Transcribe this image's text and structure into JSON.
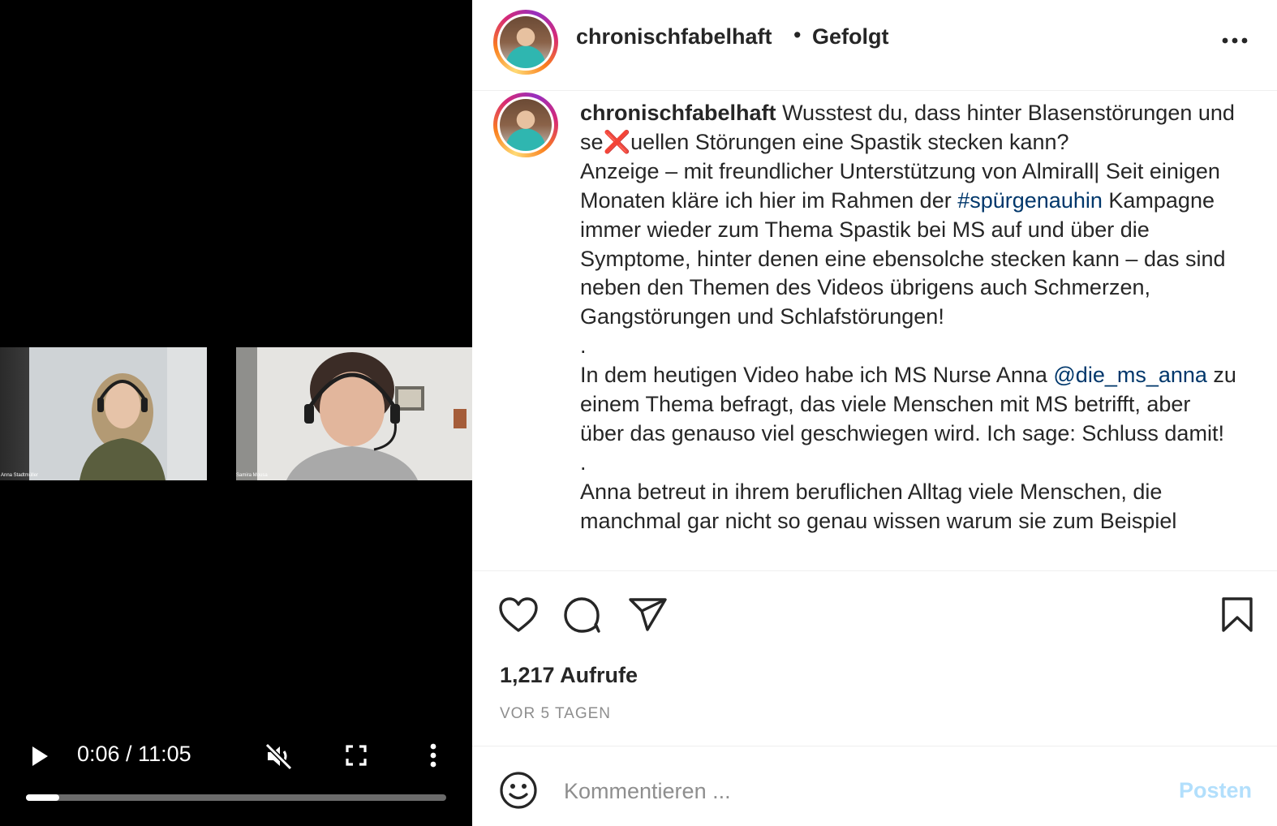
{
  "video": {
    "participants": [
      {
        "name": "Anna Stadtmüller"
      },
      {
        "name": "Samira Mousa"
      }
    ],
    "time_display": "0:06 / 11:05",
    "progress_fraction": 0.08,
    "icons": [
      "play-icon",
      "volume-muted-icon",
      "fullscreen-icon",
      "more-vertical-icon"
    ]
  },
  "header": {
    "username": "chronischfabelhaft",
    "separator": "•",
    "follow_status": "Gefolgt",
    "more_icon": "more-horizontal-icon"
  },
  "caption": {
    "username": "chronischfabelhaft",
    "line1_a": "Wusstest du, dass hinter Blasenstörungen und se",
    "emoji": "❌",
    "line1_b": "uellen Störungen eine Spastik stecken kann?",
    "para1_a": "Anzeige – mit freundlicher Unterstützung von Almirall| Seit einigen Monaten kläre ich hier im Rahmen der ",
    "hashtag": "#spürgenauhin",
    "para1_b": " Kampagne immer wieder zum Thema Spastik bei MS auf und über die Symptome, hinter denen eine ebensolche stecken kann – das sind neben den Themen des Videos übrigens auch Schmerzen, Gangstörungen und Schlafstörungen!",
    "dot1": ".",
    "para2_a": "In dem heutigen Video habe ich MS Nurse Anna ",
    "mention": "@die_ms_anna",
    "para2_b": " zu einem Thema befragt, das viele Menschen mit MS betrifft, aber über das genauso viel geschwiegen wird. Ich sage: Schluss damit!",
    "dot2": ".",
    "para3": "Anna betreut in ihrem beruflichen Alltag viele Menschen, die manchmal gar nicht so genau wissen warum sie zum Beispiel"
  },
  "actions": {
    "icons": [
      "heart-icon",
      "comment-icon",
      "share-icon",
      "bookmark-icon"
    ],
    "views": "1,217 Aufrufe",
    "date": "VOR 5 TAGEN"
  },
  "comment": {
    "icon": "emoji-icon",
    "placeholder": "Kommentieren ...",
    "post_label": "Posten"
  },
  "colors": {
    "link": "#00376b",
    "post_disabled": "#b2dffc",
    "muted_text": "#8e8e8e",
    "text": "#262626"
  }
}
